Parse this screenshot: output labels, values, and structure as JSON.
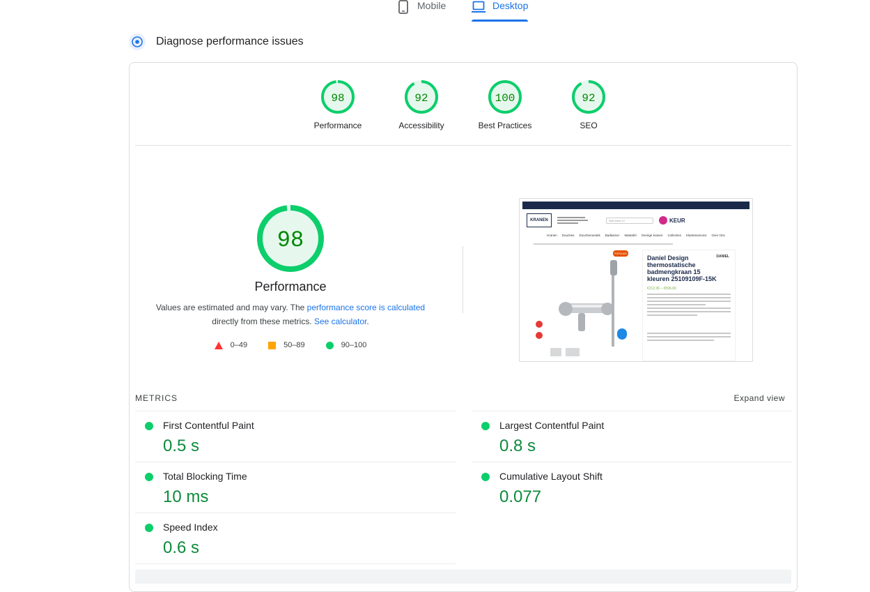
{
  "tabs": {
    "mobile": "Mobile",
    "desktop": "Desktop"
  },
  "section": {
    "title": "Diagnose performance issues"
  },
  "scores": [
    {
      "value": "98",
      "label": "Performance",
      "fraction": 0.98
    },
    {
      "value": "92",
      "label": "Accessibility",
      "fraction": 0.92
    },
    {
      "value": "100",
      "label": "Best Practices",
      "fraction": 1.0
    },
    {
      "value": "92",
      "label": "SEO",
      "fraction": 0.92
    }
  ],
  "summary": {
    "score": "98",
    "fraction": 0.98,
    "title": "Performance",
    "note_pre": "Values are estimated and may vary. The ",
    "note_link1": "performance score is calculated",
    "note_mid": " directly from these metrics. ",
    "note_link2": "See calculator",
    "note_post": ".",
    "legend": {
      "fail": "0–49",
      "average": "50–89",
      "pass": "90–100"
    }
  },
  "screenshot": {
    "logo": "KRANEN",
    "search_placeholder": "Wat zoekt u?",
    "keur": "KEUR",
    "nav": [
      "Kranen",
      "Douches",
      "Doucheroestek",
      "Badkamer",
      "Wastafel",
      "Overige kranen",
      "Collecties",
      "Klantenservice",
      "Over Ons"
    ],
    "badge": "POPULAIR",
    "brand": "DANIEL",
    "product_title": "Daniel Design thermostatische badmengkraan 15 kleuren 25109109F-15K",
    "price": "€212,36 – €506,69"
  },
  "metrics": {
    "heading": "METRICS",
    "expand": "Expand view",
    "fcp": {
      "name": "First Contentful Paint",
      "value": "0.5 s"
    },
    "lcp": {
      "name": "Largest Contentful Paint",
      "value": "0.8 s"
    },
    "tbt": {
      "name": "Total Blocking Time",
      "value": "10 ms"
    },
    "cls": {
      "name": "Cumulative Layout Shift",
      "value": "0.077"
    },
    "si": {
      "name": "Speed Index",
      "value": "0.6 s"
    }
  },
  "colors": {
    "pass": "#0cce6b",
    "pass_text": "#008800",
    "average": "#ffa400",
    "fail": "#ff3333",
    "accent": "#1a73e8"
  }
}
